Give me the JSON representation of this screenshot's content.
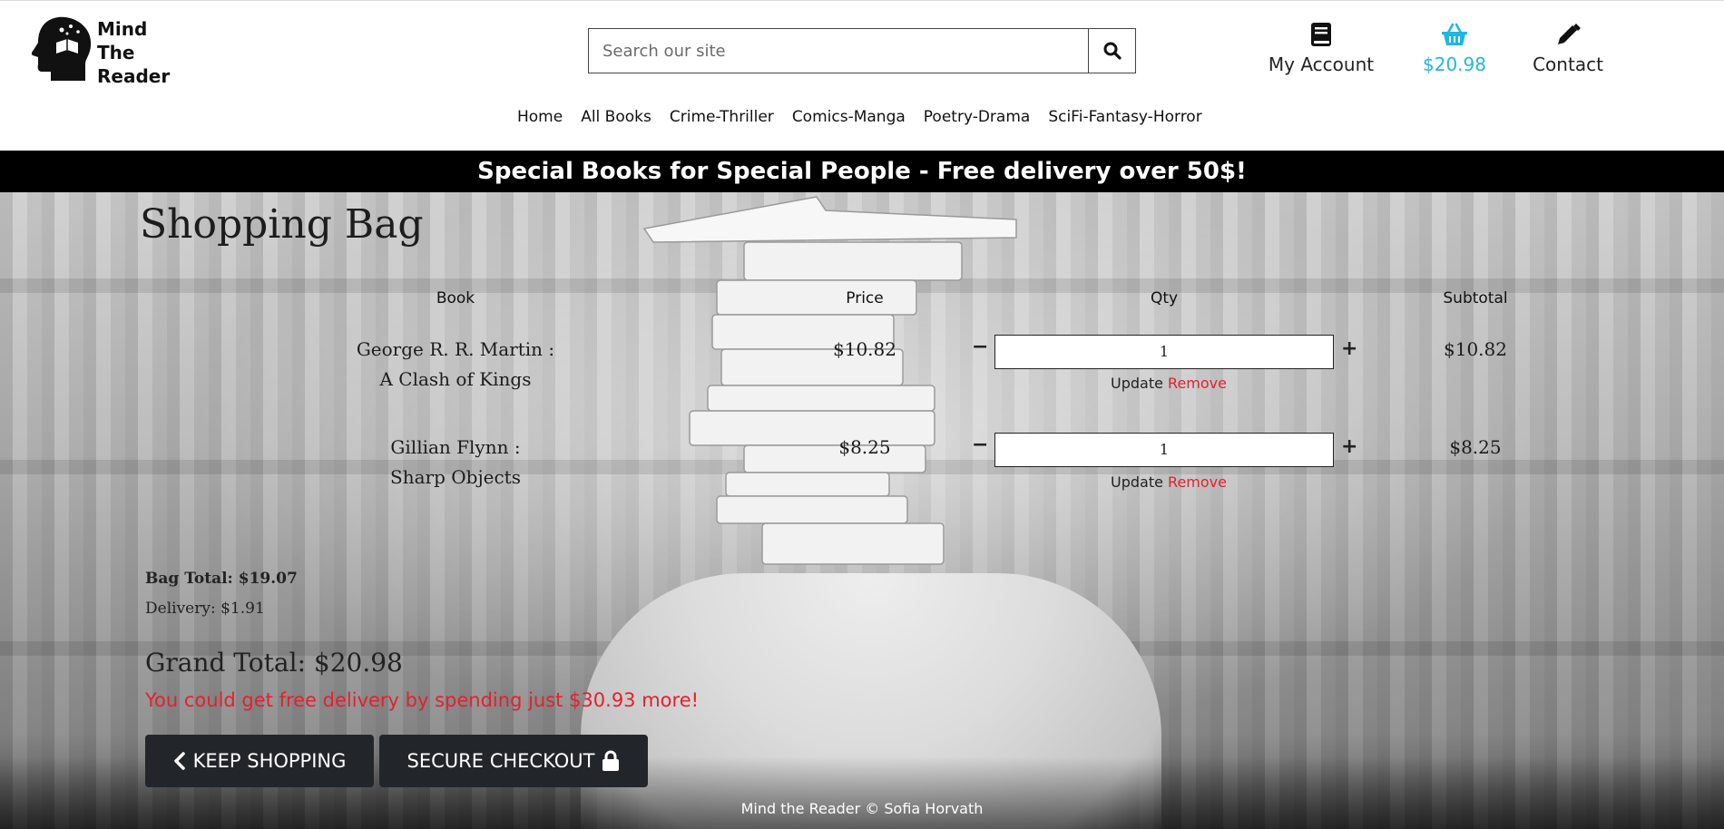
{
  "header": {
    "logo_lines": [
      "Mind",
      "The",
      "Reader"
    ],
    "search_placeholder": "Search our site",
    "account_label": "My Account",
    "bag_total": "$20.98",
    "contact_label": "Contact",
    "accent_color": "#22b6e0"
  },
  "nav": {
    "items": [
      "Home",
      "All Books",
      "Crime-Thriller",
      "Comics-Manga",
      "Poetry-Drama",
      "SciFi-Fantasy-Horror"
    ]
  },
  "banner": {
    "text": "Special Books for Special People - Free delivery over 50$!"
  },
  "bag": {
    "title": "Shopping Bag",
    "columns": [
      "Book",
      "Price",
      "Qty",
      "Subtotal"
    ],
    "items": [
      {
        "author": "George R. R. Martin :",
        "title": "A Clash of Kings",
        "price": "$10.82",
        "qty": "1",
        "subtotal": "$10.82",
        "update": "Update",
        "remove": "Remove"
      },
      {
        "author": "Gillian Flynn :",
        "title": "Sharp Objects",
        "price": "$8.25",
        "qty": "1",
        "subtotal": "$8.25",
        "update": "Update",
        "remove": "Remove"
      }
    ],
    "bag_total": "Bag Total: $19.07",
    "delivery": "Delivery: $1.91",
    "grand_total": "Grand Total: $20.98",
    "free_delivery_msg": "You could get free delivery by spending just $30.93 more!",
    "keep_shopping": "KEEP SHOPPING",
    "secure_checkout": "SECURE CHECKOUT",
    "remove_color": "#e3212d"
  },
  "footer": {
    "text": "Mind the Reader © Sofia Horvath"
  }
}
